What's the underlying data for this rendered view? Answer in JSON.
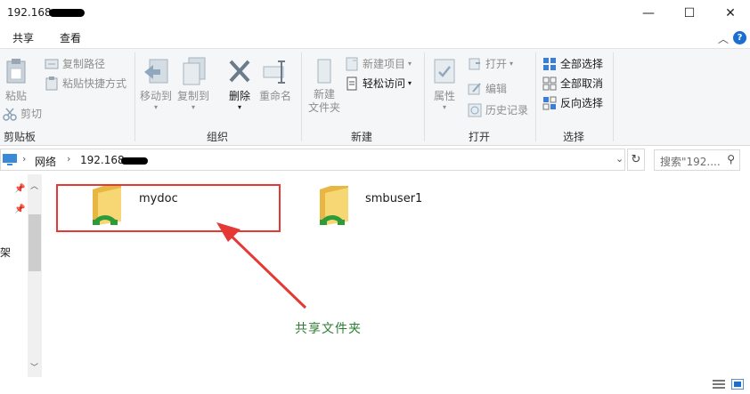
{
  "window": {
    "title": "192.168",
    "minimize": "—",
    "maximize": "☐",
    "close": "✕"
  },
  "ribbon_tabs": {
    "share": "共享",
    "view": "查看"
  },
  "ribbon": {
    "clipboard": {
      "label": "剪贴板",
      "paste": "粘贴",
      "cut": "剪切",
      "copy_path": "复制路径",
      "paste_shortcut": "粘贴快捷方式"
    },
    "organize": {
      "label": "组织",
      "move_to": "移动到",
      "copy_to": "复制到",
      "delete": "删除",
      "rename": "重命名"
    },
    "new": {
      "label": "新建",
      "new_folder": "新建\n文件夹",
      "new_item": "新建项目",
      "easy_access": "轻松访问"
    },
    "open": {
      "label": "打开",
      "properties": "属性",
      "open": "打开",
      "edit": "编辑",
      "history": "历史记录"
    },
    "select": {
      "label": "选择",
      "select_all": "全部选择",
      "select_none": "全部取消",
      "invert": "反向选择"
    }
  },
  "address": {
    "crumbs": [
      "网络",
      "192.168"
    ],
    "search_placeholder": "搜索\"192...."
  },
  "items": [
    {
      "name": "mydoc"
    },
    {
      "name": "smbuser1"
    }
  ],
  "nav_partial_text": "架",
  "annotation": "共享文件夹",
  "colors": {
    "annotation_box": "#e53935",
    "annotation_text": "#2e7d32",
    "accent": "#1a6fd1"
  }
}
